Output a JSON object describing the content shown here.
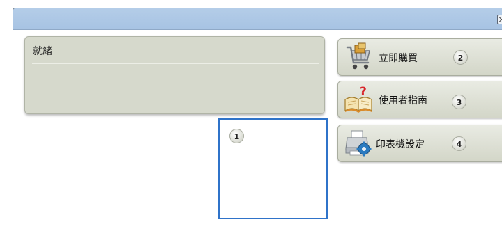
{
  "status": {
    "text": "就緒"
  },
  "preview": {
    "badge": "1"
  },
  "buttons": [
    {
      "label": "立即購買",
      "badge": "2",
      "icon": "shopping-cart-icon"
    },
    {
      "label": "使用者指南",
      "badge": "3",
      "icon": "user-guide-book-icon"
    },
    {
      "label": "印表機設定",
      "badge": "4",
      "icon": "printer-settings-icon"
    }
  ],
  "colors": {
    "titlebar": "#a7c3e3",
    "panel": "#d6d9cc",
    "button": "#dfe1d7",
    "preview_border": "#2f73c9"
  }
}
